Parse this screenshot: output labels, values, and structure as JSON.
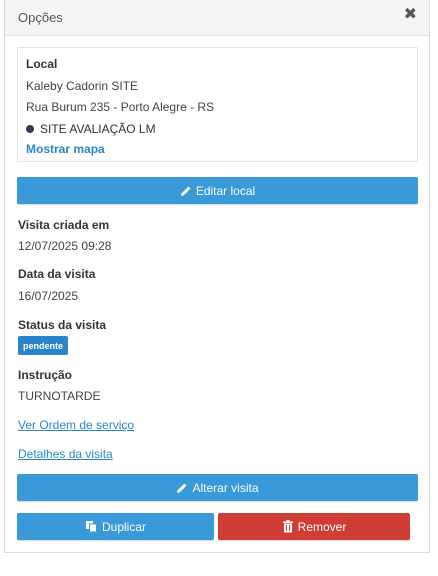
{
  "header": {
    "title": "Opções",
    "close_symbol": "✖"
  },
  "local": {
    "title": "Local",
    "name": "Kaleby Cadorin SITE",
    "address": "Rua Burum 235 - Porto Alegre - RS",
    "site": "SITE AVALIAÇÃO LM",
    "map_link": "Mostrar mapa"
  },
  "buttons": {
    "edit_local": "Editar local",
    "edit_visit": "Alterar visita",
    "duplicate": "Duplicar",
    "remove": "Remover"
  },
  "details": {
    "created_label": "Visita criada em",
    "created_value": "12/07/2025 09:28",
    "date_label": "Data da visita",
    "date_value": "16/07/2025",
    "status_label": "Status da visita",
    "status_value": "pendente",
    "instruction_label": "Instrução",
    "instruction_value": "TURNOTARDE"
  },
  "links": {
    "service_order": "Ver Ordem de serviço",
    "visit_details": "Detalhes da visita"
  },
  "colors": {
    "primary": "#3a9ad9",
    "danger": "#d03d34",
    "badge": "#2a84cc",
    "link": "#2a88c8"
  },
  "icons": {
    "close": "close-icon",
    "edit": "pencil-icon",
    "duplicate": "copy-icon",
    "remove": "trash-icon",
    "site_marker": "dot-icon"
  }
}
